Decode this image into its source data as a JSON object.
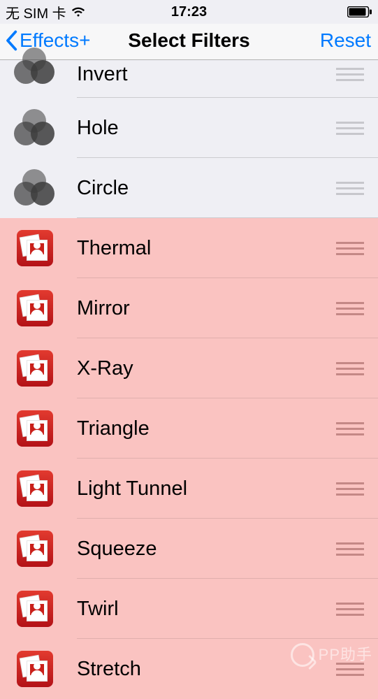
{
  "status": {
    "carrier": "无 SIM 卡",
    "time": "17:23"
  },
  "nav": {
    "back_label": "Effects+",
    "title": "Select Filters",
    "reset_label": "Reset"
  },
  "filters": {
    "gray": [
      {
        "label": "Invert"
      },
      {
        "label": "Hole"
      },
      {
        "label": "Circle"
      }
    ],
    "pink": [
      {
        "label": "Thermal"
      },
      {
        "label": "Mirror"
      },
      {
        "label": "X-Ray"
      },
      {
        "label": "Triangle"
      },
      {
        "label": "Light Tunnel"
      },
      {
        "label": "Squeeze"
      },
      {
        "label": "Twirl"
      },
      {
        "label": "Stretch"
      }
    ]
  },
  "watermark": {
    "text": "PP助手"
  }
}
